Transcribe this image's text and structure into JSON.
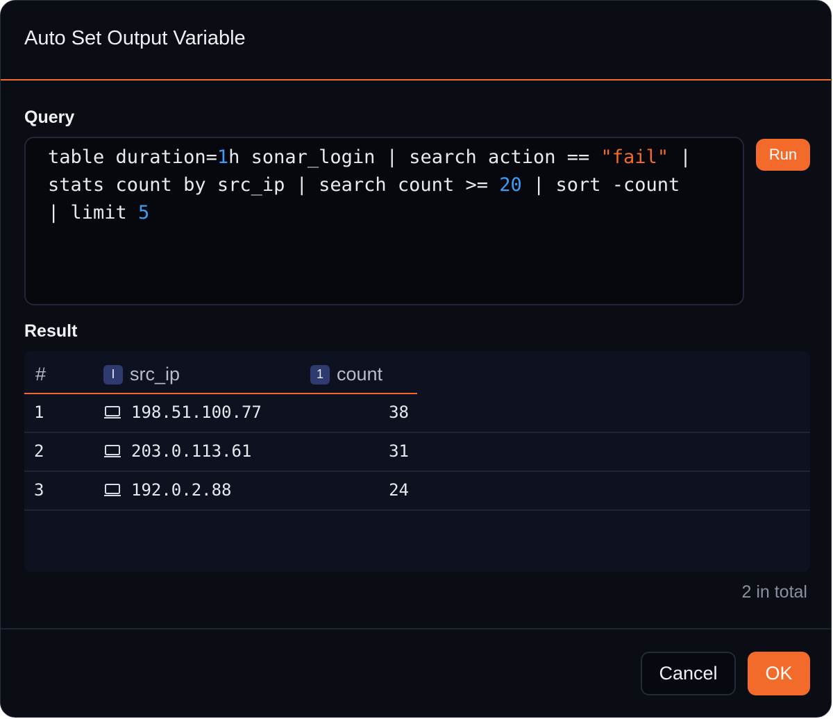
{
  "dialog": {
    "title": "Auto Set Output Variable"
  },
  "query": {
    "label": "Query",
    "run_label": "Run",
    "tokens": [
      {
        "text": "table duration=",
        "kind": "plain"
      },
      {
        "text": "1",
        "kind": "num"
      },
      {
        "text": "h sonar_login | search action == ",
        "kind": "plain"
      },
      {
        "text": "\"fail\"",
        "kind": "str"
      },
      {
        "text": " |\nstats count by src_ip | search count >= ",
        "kind": "plain"
      },
      {
        "text": "20",
        "kind": "num"
      },
      {
        "text": " | sort -count\n| limit ",
        "kind": "plain"
      },
      {
        "text": "5",
        "kind": "num"
      }
    ],
    "colors": {
      "number": "#3d9df5",
      "string": "#f26b2a"
    }
  },
  "result": {
    "label": "Result",
    "columns": [
      {
        "label": "#",
        "badge": ""
      },
      {
        "label": "src_ip",
        "badge": "I"
      },
      {
        "label": "count",
        "badge": "1"
      }
    ],
    "rows": [
      {
        "index": "1",
        "src_ip": "198.51.100.77",
        "count": "38"
      },
      {
        "index": "2",
        "src_ip": "203.0.113.61",
        "count": "31"
      },
      {
        "index": "3",
        "src_ip": "192.0.2.88",
        "count": "24"
      }
    ],
    "row_icon": "laptop-icon",
    "total": "2 in total"
  },
  "footer": {
    "cancel_label": "Cancel",
    "ok_label": "OK"
  },
  "theme": {
    "accent": "#f26b2a",
    "background": "#0b0d14",
    "badge": "#2f3a6e"
  }
}
